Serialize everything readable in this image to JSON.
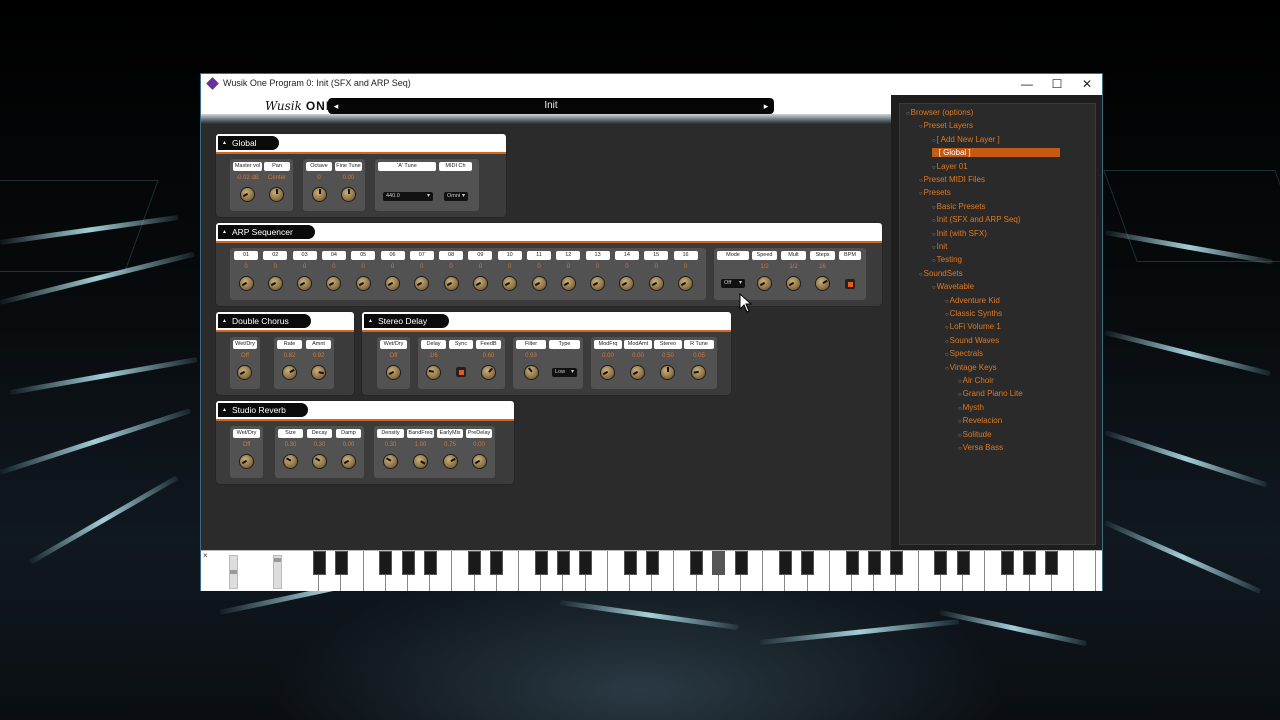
{
  "window": {
    "title": "Wusik One Program 0: Init (SFX and ARP Seq)",
    "minimize": "—",
    "maximize": "☐",
    "close": "✕"
  },
  "header": {
    "logo_script": "Wusik",
    "logo_text": "ONE",
    "preset_name": "Init",
    "prev_arrow": "◂",
    "next_arrow": "▸"
  },
  "global": {
    "title": "Global",
    "labels": [
      "Master vol",
      "Pan",
      "Octave",
      "Fine Tune",
      "'A' Tune",
      "MIDI Ch"
    ],
    "values": [
      "-0.02 dB",
      "Center",
      "0",
      "0.00"
    ],
    "a_tune": "440.0",
    "midi_ch": "Omni"
  },
  "arp": {
    "title": "ARP Sequencer",
    "steps": [
      "01",
      "02",
      "03",
      "04",
      "05",
      "06",
      "07",
      "08",
      "09",
      "10",
      "11",
      "12",
      "13",
      "14",
      "15",
      "16"
    ],
    "step_values": [
      "0",
      "0",
      "0",
      "0",
      "0",
      "0",
      "0",
      "0",
      "0",
      "0",
      "0",
      "0",
      "0",
      "0",
      "0",
      "0"
    ],
    "controls": [
      "Mode",
      "Speed",
      "Mult",
      "Steps",
      "BPM"
    ],
    "control_values": [
      "1/2",
      "1/2",
      "16"
    ],
    "mode": "Off"
  },
  "chorus": {
    "title": "Double Chorus",
    "labels": [
      "Wet/Dry",
      "Rate",
      "Amnt"
    ],
    "values": [
      "Off",
      "0.82",
      "0.92"
    ]
  },
  "delay": {
    "title": "Stereo Delay",
    "labels": [
      "Wet/Dry",
      "Delay",
      "Sync",
      "FeedB",
      "Filter",
      "Type",
      "ModFrq",
      "ModAmt",
      "Stereo",
      "R Tune"
    ],
    "values": [
      "Off",
      "1/6",
      "0.60",
      "0.93",
      "0.00",
      "0.00",
      "0.50",
      "0.05"
    ],
    "type": "Low"
  },
  "reverb": {
    "title": "Studio Reverb",
    "labels": [
      "Wet/Dry",
      "Size",
      "Decay",
      "Damp",
      "Density",
      "BandFreq",
      "EarlyMix",
      "PreDelay"
    ],
    "values": [
      "Off",
      "0.30",
      "0.30",
      "0.00",
      "0.30",
      "1.00",
      "0.75",
      "0.00"
    ]
  },
  "browser": {
    "items": [
      {
        "label": "Browser (options)",
        "depth": 0
      },
      {
        "label": "Preset Layers",
        "depth": 1
      },
      {
        "label": "[ Add New Layer ]",
        "depth": 2
      },
      {
        "label": "[ Global ]",
        "depth": 2,
        "selected": true
      },
      {
        "label": "Layer 01",
        "depth": 2
      },
      {
        "label": "Preset MIDI Files",
        "depth": 1
      },
      {
        "label": "Presets",
        "depth": 1
      },
      {
        "label": "Basic Presets",
        "depth": 2
      },
      {
        "label": "Init (SFX and ARP Seq)",
        "depth": 2
      },
      {
        "label": "Init (with SFX)",
        "depth": 2
      },
      {
        "label": "Init",
        "depth": 2
      },
      {
        "label": "Testing",
        "depth": 2
      },
      {
        "label": "SoundSets",
        "depth": 1
      },
      {
        "label": "Wavetable",
        "depth": 2
      },
      {
        "label": "Adventure Kid",
        "depth": 3
      },
      {
        "label": "Classic Synths",
        "depth": 3
      },
      {
        "label": "LoFi Volume 1",
        "depth": 3
      },
      {
        "label": "Sound Waves",
        "depth": 3
      },
      {
        "label": "Spectrals",
        "depth": 3
      },
      {
        "label": "Vintage Keys",
        "depth": 3
      },
      {
        "label": "Air Choir",
        "depth": 4
      },
      {
        "label": "Grand Piano Lite",
        "depth": 4
      },
      {
        "label": "Mysth",
        "depth": 4
      },
      {
        "label": "Revelacion",
        "depth": 4
      },
      {
        "label": "Solitude",
        "depth": 4
      },
      {
        "label": "Versa Bass",
        "depth": 4
      }
    ]
  },
  "keyboard": {
    "close_mark": "×"
  },
  "colors": {
    "accent": "#d2681f",
    "browser_text": "#e0781e",
    "selection": "#c55a14"
  }
}
